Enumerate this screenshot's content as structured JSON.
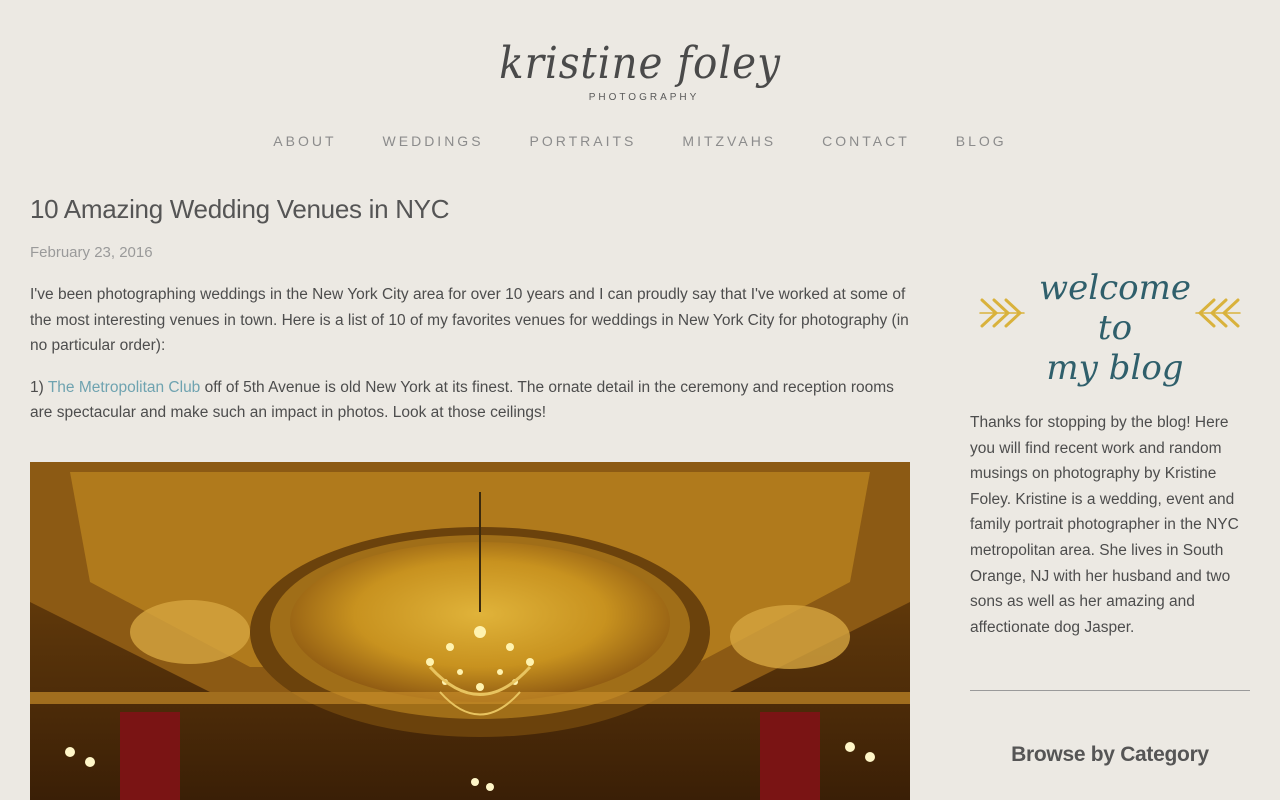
{
  "header": {
    "logo_script": "kristine foley",
    "logo_sub": "PHOTOGRAPHY"
  },
  "nav": {
    "items": [
      {
        "label": "ABOUT"
      },
      {
        "label": "WEDDINGS"
      },
      {
        "label": "PORTRAITS"
      },
      {
        "label": "MITZVAHS"
      },
      {
        "label": "CONTACT"
      },
      {
        "label": "BLOG"
      }
    ]
  },
  "post": {
    "title": "10 Amazing Wedding Venues in NYC",
    "date": "February 23, 2016",
    "intro": "I've been photographing weddings in the New York City area for over 10 years and I can proudly say that I've worked at some of the most interesting venues in town. Here is a list of 10 of my favorites venues for weddings in New York City for photography (in no particular order):",
    "item1_prefix": "1) ",
    "item1_link": "The Metropolitan Club",
    "item1_text": " off of 5th Avenue is old New York at its finest. The ornate detail in the ceremony and reception rooms are spectacular and make such an impact in photos. Look at those ceilings!"
  },
  "sidebar": {
    "welcome_line1": "welcome to",
    "welcome_line2": "my blog",
    "about_text": "Thanks for stopping by the blog! Here you will find recent work and random musings on photography by Kristine Foley. Kristine is a wedding, event and family portrait photographer in the NYC metropolitan area. She lives in South Orange, NJ with her husband and two sons as well as her amazing and affectionate dog Jasper.",
    "browse_heading": "Browse by Category"
  },
  "colors": {
    "background": "#ece9e3",
    "link": "#6fa3b0",
    "welcome_teal": "#2f5f6b",
    "arrow_gold": "#d9b23c"
  }
}
